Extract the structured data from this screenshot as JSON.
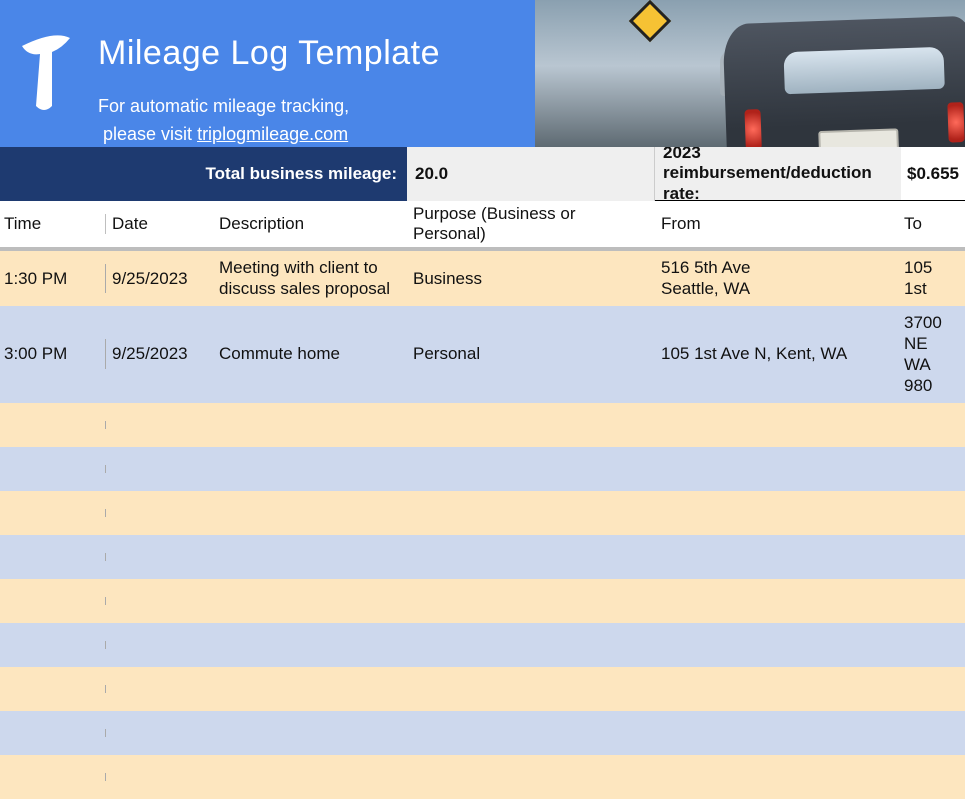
{
  "header": {
    "title": "Mileage Log Template",
    "subtitle_line1": "For automatic mileage tracking,",
    "subtitle_line2_prefix": "please visit ",
    "subtitle_link_text": "triplogmileage.com"
  },
  "summary": {
    "business_label": "Total business mileage:",
    "business_value": "20.0",
    "rate_label": "2023 reimbursement/deduction rate:",
    "rate_value": "$0.655"
  },
  "columns": {
    "time": "Time",
    "date": "Date",
    "description": "Description",
    "purpose": "Purpose (Business or Personal)",
    "from": "From",
    "to": "To"
  },
  "rows": [
    {
      "time": "1:30 PM",
      "date": "9/25/2023",
      "description": "Meeting with client to discuss sales proposal",
      "purpose": "Business",
      "from": "516 5th Ave\nSeattle, WA",
      "to": "105 1st"
    },
    {
      "time": "3:00 PM",
      "date": "9/25/2023",
      "description": "Commute home",
      "purpose": "Personal",
      "from": "105 1st Ave N, Kent, WA",
      "to": "3700 NE\nWA 980"
    },
    {
      "time": "",
      "date": "",
      "description": "",
      "purpose": "",
      "from": "",
      "to": ""
    },
    {
      "time": "",
      "date": "",
      "description": "",
      "purpose": "",
      "from": "",
      "to": ""
    },
    {
      "time": "",
      "date": "",
      "description": "",
      "purpose": "",
      "from": "",
      "to": ""
    },
    {
      "time": "",
      "date": "",
      "description": "",
      "purpose": "",
      "from": "",
      "to": ""
    },
    {
      "time": "",
      "date": "",
      "description": "",
      "purpose": "",
      "from": "",
      "to": ""
    },
    {
      "time": "",
      "date": "",
      "description": "",
      "purpose": "",
      "from": "",
      "to": ""
    },
    {
      "time": "",
      "date": "",
      "description": "",
      "purpose": "",
      "from": "",
      "to": ""
    },
    {
      "time": "",
      "date": "",
      "description": "",
      "purpose": "",
      "from": "",
      "to": ""
    },
    {
      "time": "",
      "date": "",
      "description": "",
      "purpose": "",
      "from": "",
      "to": ""
    }
  ]
}
